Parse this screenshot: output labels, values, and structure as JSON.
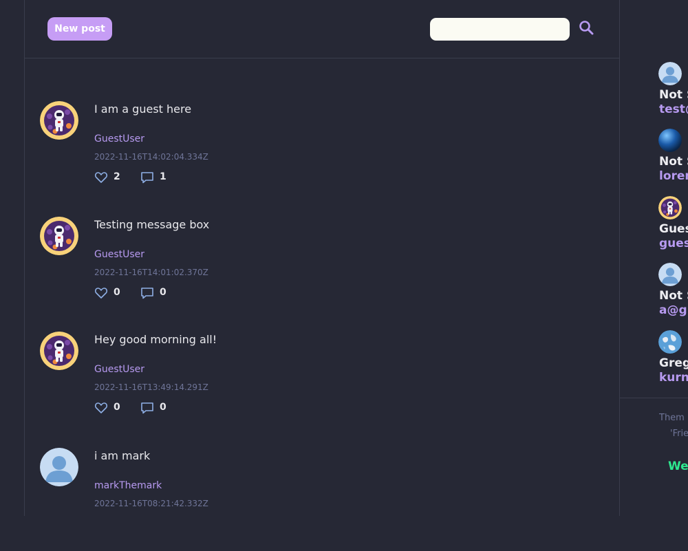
{
  "header": {
    "new_post_label": "New post",
    "search_placeholder": "",
    "search_value": ""
  },
  "posts": [
    {
      "text": "I am a guest here",
      "user": "GuestUser",
      "timestamp": "2022-11-16T14:02:04.334Z",
      "likes": "2",
      "comments": "1",
      "avatar": "astronaut-avatar"
    },
    {
      "text": "Testing message box",
      "user": "GuestUser",
      "timestamp": "2022-11-16T14:01:02.370Z",
      "likes": "0",
      "comments": "0",
      "avatar": "astronaut-avatar"
    },
    {
      "text": "Hey good morning all!",
      "user": "GuestUser",
      "timestamp": "2022-11-16T13:49:14.291Z",
      "likes": "0",
      "comments": "0",
      "avatar": "astronaut-avatar"
    },
    {
      "text": "i am mark",
      "user": "markThemark",
      "timestamp": "2022-11-16T08:21:42.332Z",
      "likes": "",
      "comments": "",
      "avatar": "default-user-avatar"
    }
  ],
  "sidebar": {
    "users": [
      {
        "name": "Not S",
        "email": "test@",
        "avatar": "default-user-avatar"
      },
      {
        "name": "Not S",
        "email": "lorem",
        "avatar": "blue-sphere-avatar"
      },
      {
        "name": "Gues",
        "email": "guest",
        "avatar": "astronaut-avatar"
      },
      {
        "name": "Not S",
        "email": "a@gr",
        "avatar": "default-user-avatar"
      },
      {
        "name": "Greg",
        "email": "kurni",
        "avatar": "earth-avatar"
      }
    ],
    "footer_line1": "Them",
    "footer_line2": "'Frie",
    "footer_line3": "We"
  },
  "colors": {
    "background": "#262835",
    "accent": "#c69df5",
    "link": "#b79af0",
    "muted": "#6f7598",
    "green": "#2ee88f",
    "search_bg": "#fbfbf3"
  }
}
